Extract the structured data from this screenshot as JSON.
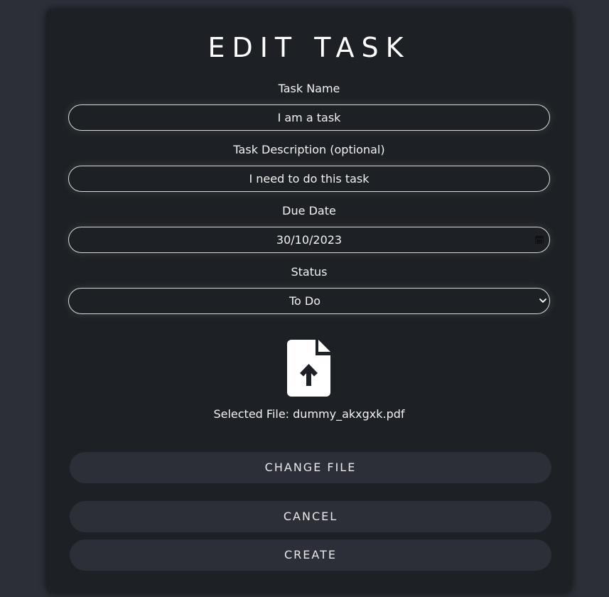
{
  "form": {
    "title": "EDIT TASK",
    "task_name_label": "Task Name",
    "task_name_value": "I am a task",
    "task_description_label": "Task Description (optional)",
    "task_description_value": "I need to do this task",
    "due_date_label": "Due Date",
    "due_date_value": "30/10/2023",
    "status_label": "Status",
    "status_value": "To Do",
    "file_upload_icon": "file-upload-icon",
    "selected_file_text": "Selected File: dummy_akxgxk.pdf",
    "change_file_label": "CHANGE FILE",
    "cancel_label": "CANCEL",
    "create_label": "CREATE"
  },
  "colors": {
    "page_background": "#2c2f37",
    "card_background": "#1d2024",
    "button_background": "#2c2f37",
    "text": "#f2f2f2"
  }
}
